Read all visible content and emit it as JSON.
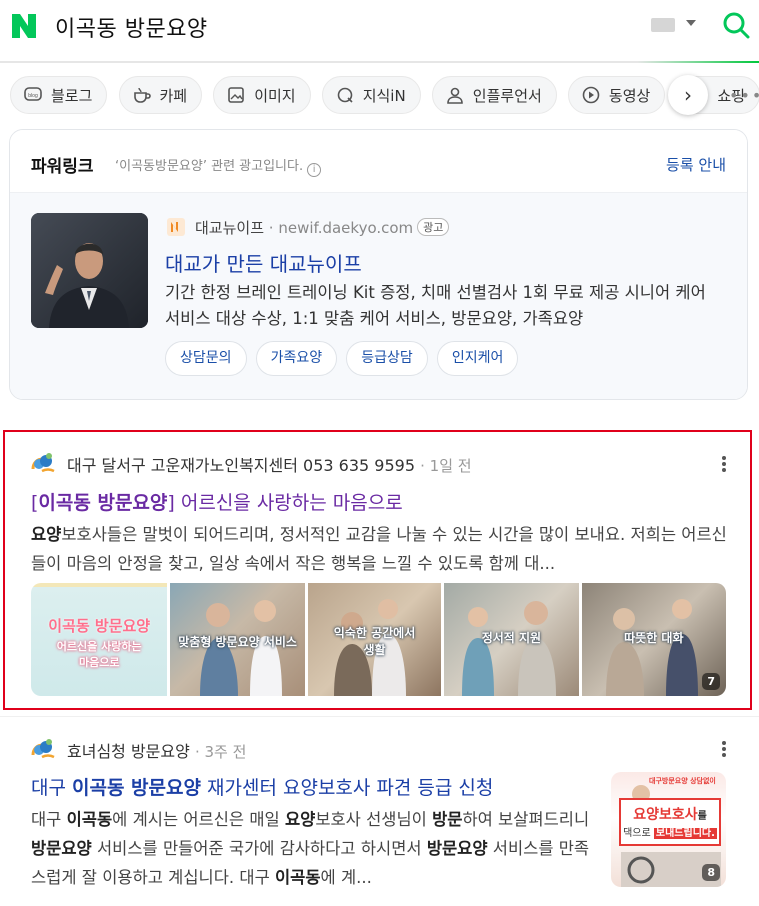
{
  "header": {
    "query": "이곡동 방문요양"
  },
  "tabs": [
    {
      "label": "블로그",
      "icon": "blog-icon"
    },
    {
      "label": "카페",
      "icon": "cafe-cup-icon"
    },
    {
      "label": "이미지",
      "icon": "image-icon"
    },
    {
      "label": "지식iN",
      "icon": "knowledge-q-icon"
    },
    {
      "label": "인플루언서",
      "icon": "person-icon"
    },
    {
      "label": "동영상",
      "icon": "play-icon"
    },
    {
      "label": "쇼핑",
      "icon": "shopping-bag-icon"
    }
  ],
  "powerlink": {
    "title": "파워링크",
    "subtitle": "‘이곡동방문요양’ 관련 광고입니다.",
    "info_glyph": "i",
    "register": "등록 안내",
    "ad": {
      "site_name": "대교뉴이프",
      "url": "newif.daekyo.com",
      "badge": "광고",
      "title": "대교가 만든 대교뉴이프",
      "desc": "기간 한정 브레인 트레이닝 Kit 증정, 치매 선별검사 1회 무료 제공 시니어 케어 서비스 대상 수상, 1:1 맞춤 케어 서비스, 방문요양, 가족요양",
      "chips": [
        "상담문의",
        "가족요양",
        "등급상담",
        "인지케어"
      ]
    }
  },
  "result1": {
    "source": "대구 달서구 고운재가노인복지센터 053 635 9595",
    "time": "1일 전",
    "title_bracket_open": "[",
    "title_keyword": "이곡동 방문요양",
    "title_bracket_close": "]",
    "title_rest": " 어르신을 사랑하는 마음으로",
    "desc_bold1": "요양",
    "desc_rest": "보호사들은 말벗이 되어드리며, 정서적인 교감을 나눌 수 있는 시간을 많이 보내요. 저희는 어르신들이 마음의 안정을 찾고, 일상 속에서 작은 행복을 느낄 수 있도록 함께 대...",
    "images": [
      {
        "caption_main": "이곡동 방문요양",
        "caption_sub": "어르신을 사랑하는\n마음으로"
      },
      {
        "caption": "맞춤형 방문요양 서비스"
      },
      {
        "caption": "익숙한 공간에서\n생활"
      },
      {
        "caption": "정서적 지원"
      },
      {
        "caption": "따뜻한 대화"
      }
    ],
    "image_count": "7"
  },
  "result2": {
    "source": "효녀심청 방문요양",
    "time": "3주 전",
    "title_a": "대구 ",
    "title_b": "이곡동 방문요양",
    "title_c": " 재가센터 요양보호사 파견 등급 신청",
    "desc": [
      {
        "t": "대구 ",
        "b": false
      },
      {
        "t": "이곡동",
        "b": true
      },
      {
        "t": "에 계시는 어르신은 매일 ",
        "b": false
      },
      {
        "t": "요양",
        "b": true
      },
      {
        "t": "보호사 선생님이 ",
        "b": false
      },
      {
        "t": "방문",
        "b": true
      },
      {
        "t": "하여 보살펴드리니 ",
        "b": false
      },
      {
        "t": "방문요양",
        "b": true
      },
      {
        "t": " 서비스를 만들어준 국가에 감사하다고 하시면서 ",
        "b": false
      },
      {
        "t": "방문요양",
        "b": true
      },
      {
        "t": " 서비스를 만족스럽게 잘 이용하고 계십니다. 대구 ",
        "b": false
      },
      {
        "t": "이곡동",
        "b": true
      },
      {
        "t": "에 계...",
        "b": false
      }
    ],
    "thumb_count": "8",
    "thumb_top": "대구방문요양 상담없이",
    "thumb_mid": "요양보호사",
    "thumb_mid2": "를",
    "thumb_low": "댁으로",
    "thumb_low2": "보내드립니다."
  },
  "colors": {
    "naver_green": "#03c75a",
    "link_blue": "#1b3fa6",
    "visited_purple": "#6a2aa3",
    "highlight_red": "#e0001b"
  }
}
